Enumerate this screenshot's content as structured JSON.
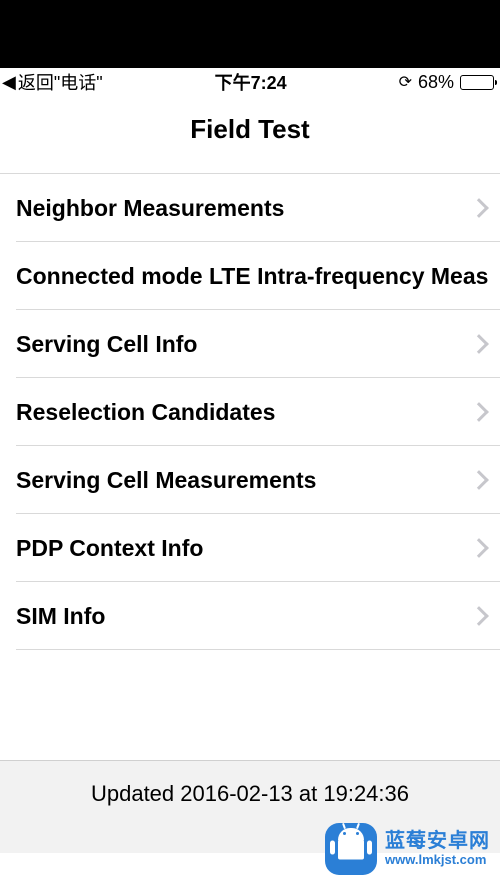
{
  "status": {
    "back_text": "返回\"电话\"",
    "time": "下午7:24",
    "battery_pct": "68%"
  },
  "nav": {
    "title": "Field Test"
  },
  "items": [
    {
      "label": "Neighbor Measurements"
    },
    {
      "label": "Connected mode LTE Intra-frequency Meas"
    },
    {
      "label": "Serving Cell Info"
    },
    {
      "label": "Reselection Candidates"
    },
    {
      "label": "Serving Cell Measurements"
    },
    {
      "label": "PDP Context Info"
    },
    {
      "label": "SIM Info"
    }
  ],
  "footer": {
    "updated": "Updated 2016-02-13 at 19:24:36"
  },
  "watermark": {
    "name": "蓝莓安卓网",
    "url": "www.lmkjst.com"
  }
}
